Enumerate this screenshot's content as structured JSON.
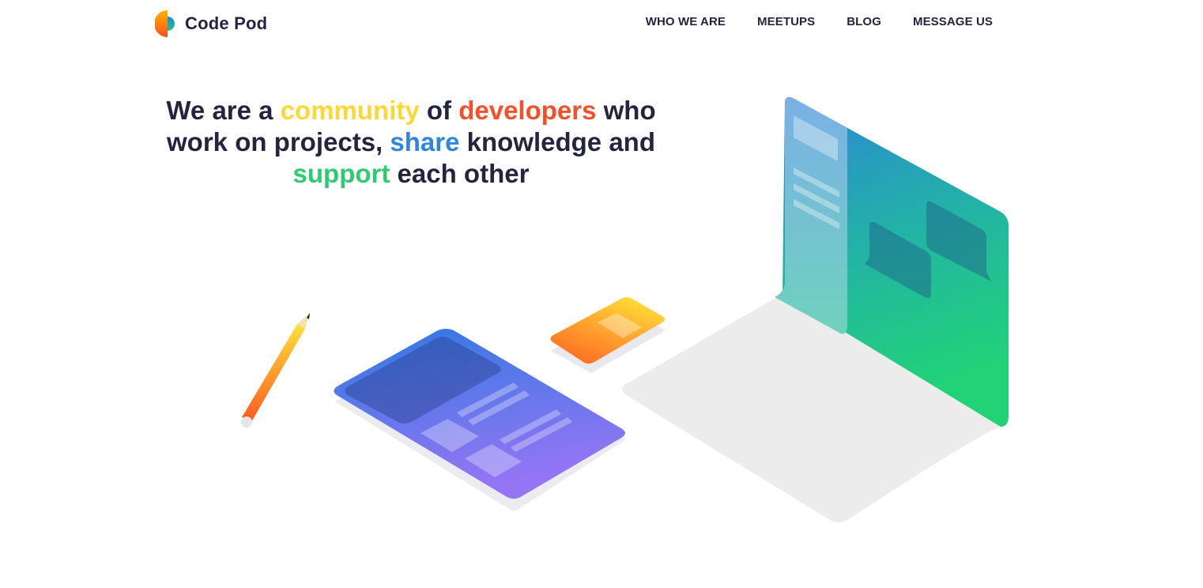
{
  "header": {
    "logo_text": "Code Pod",
    "nav": [
      {
        "label": "WHO WE ARE"
      },
      {
        "label": "MEETUPS"
      },
      {
        "label": "BLOG"
      },
      {
        "label": "MESSAGE US"
      }
    ]
  },
  "hero": {
    "line1_a": "We are a ",
    "line1_community": "community",
    "line1_b": " of ",
    "line1_developers": "developers",
    "line1_c": " who",
    "line2_a": "work on projects, ",
    "line2_share": "share",
    "line2_b": " knowledge and",
    "line3_support": "support",
    "line3_b": " each other"
  },
  "colors": {
    "text_dark": "#23243f",
    "accent_yellow": "#fdd835",
    "accent_red": "#f4502a",
    "accent_blue": "#2e86de",
    "accent_green": "#2ecc71"
  }
}
